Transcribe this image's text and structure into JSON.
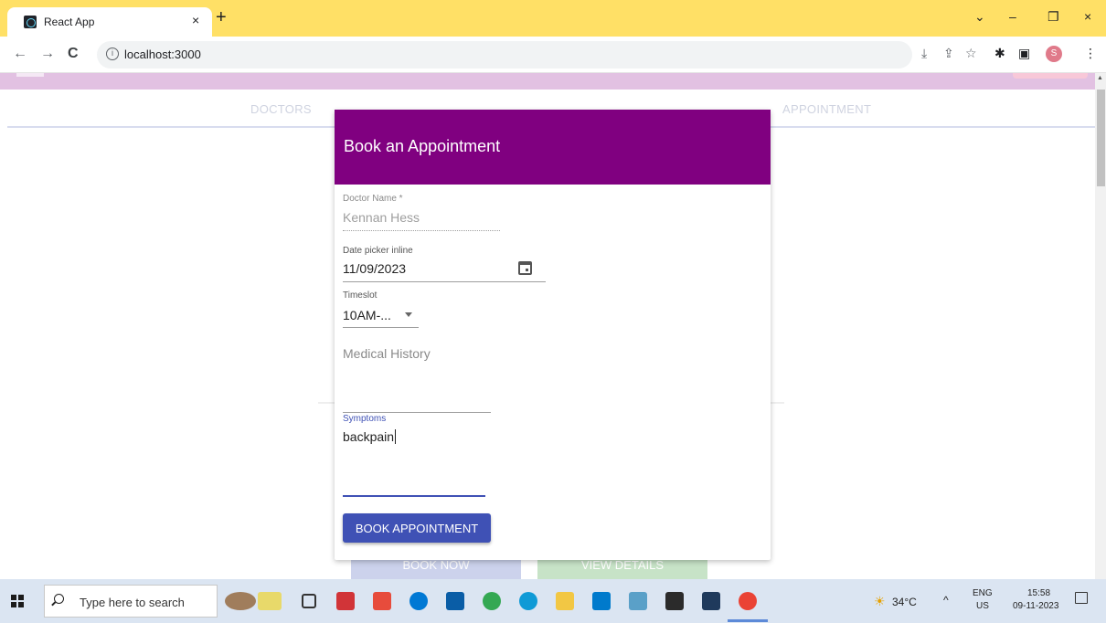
{
  "browser": {
    "tab_title": "React App",
    "tab_close": "×",
    "new_tab": "+",
    "url": "localhost:3000",
    "profile_initial": "S",
    "controls": {
      "chevron": "⌄",
      "minimize": "–",
      "restore": "❐",
      "close": "×"
    }
  },
  "page": {
    "nav_tabs": [
      "DOCTORS",
      "APPOINTMENT"
    ],
    "ghost_buttons": [
      "BOOK NOW",
      "VIEW DETAILS"
    ]
  },
  "dialog": {
    "title": "Book an Appointment",
    "doctor_label": "Doctor Name *",
    "doctor_value": "Kennan Hess",
    "date_label": "Date picker inline",
    "date_value": "11/09/2023",
    "timeslot_label": "Timeslot",
    "timeslot_value": "10AM-...",
    "medical_history_placeholder": "Medical History",
    "symptoms_label": "Symptoms",
    "symptoms_value": "backpain",
    "submit_label": "BOOK APPOINTMENT"
  },
  "taskbar": {
    "search_placeholder": "Type here to search",
    "temperature": "34°C",
    "lang_top": "ENG",
    "lang_bottom": "US",
    "time": "15:58",
    "date": "09-11-2023"
  },
  "colors": {
    "tab_strip": "#ffe066",
    "dialog_header": "#800080",
    "primary_button": "#3f51b5",
    "appbar": "#e2c1e2"
  }
}
